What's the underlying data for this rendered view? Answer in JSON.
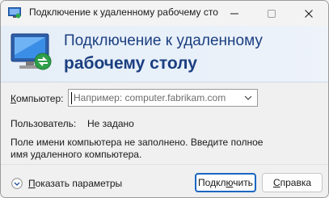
{
  "window": {
    "title": "Подключение к удаленному рабочему сто",
    "controls": {
      "minimize": "minimize",
      "maximize": "maximize",
      "close": "close"
    }
  },
  "banner": {
    "line1": "Подключение к удаленному",
    "line2": "рабочему столу"
  },
  "form": {
    "computer_label_underlined": "К",
    "computer_label_rest": "омпьютер:",
    "computer_placeholder": "Например: computer.fabrikam.com",
    "user_label": "Пользователь:",
    "user_value": "Не задано",
    "message": "Поле имени компьютера не заполнено. Введите полное имя удаленного компьютера."
  },
  "footer": {
    "options_label_underlined": "П",
    "options_label_rest": "оказать параметры",
    "connect_label_pre": "Подкл",
    "connect_label_underlined": "ю",
    "connect_label_post": "чить",
    "help_label_underlined": "С",
    "help_label_rest": "правка"
  },
  "colors": {
    "accent": "#1a66c2",
    "banner_text": "#1b3f80"
  }
}
